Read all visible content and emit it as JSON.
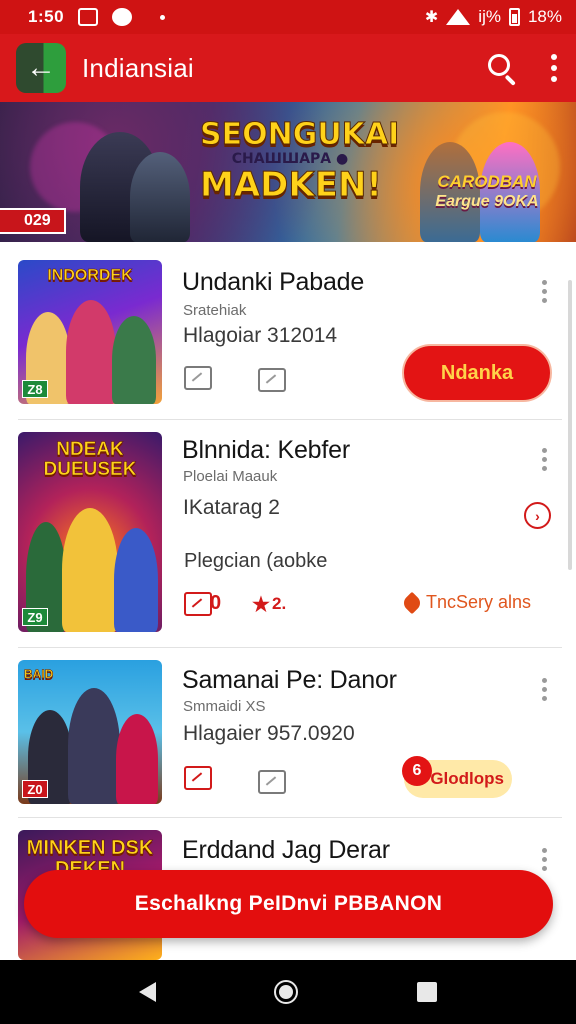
{
  "status_bar": {
    "time": "1:50",
    "battery_text": "іј%",
    "extra_text": "18%"
  },
  "app_bar": {
    "title": "Indiansiai",
    "back_icon": "arrow-left-icon",
    "search_icon": "search-icon",
    "menu_icon": "more-vert-icon"
  },
  "banner": {
    "headline_top": "SEONGUKAI",
    "headline_mid": "СНАШШАРА ●",
    "headline_bottom": "MADKEN!",
    "sub_line1": "CARODBAN",
    "sub_line2": "Eargue 9OKA",
    "badge": "029"
  },
  "items": [
    {
      "thumb_label": "INDORDEK",
      "thumb_badge": "Z8",
      "title": "Undanki Pabade",
      "subtitle": "Sratehiak",
      "meta": "Hlagoiar 312014",
      "action_label": "Ndanka",
      "colors": [
        "#2a4ac8",
        "#b3205a",
        "#f2a23a"
      ]
    },
    {
      "thumb_label": "NDEAK DUEUSEK",
      "thumb_badge": "Z9",
      "title": "Blnnida: Kebfer",
      "subtitle": "Ploelai Maauk",
      "meta": "IKatarag 2",
      "status": "Plegcian (aobke",
      "rating_a": "0",
      "rating_b": "2.",
      "trend_label": "TncSery alns",
      "colors": [
        "#ff7a1a",
        "#7a2a9a",
        "#2a6a3a"
      ]
    },
    {
      "thumb_label": "BAID",
      "thumb_badge": "Z0",
      "title": "Samanai Pe: Danor",
      "subtitle": "Smmaidi XS",
      "meta": "Hlagaier 957.0920",
      "pill_label": "Glodlops",
      "pill_number": "6",
      "colors": [
        "#2aa0e0",
        "#7a3a1a",
        "#c8151b"
      ]
    },
    {
      "thumb_label": "MINKEN DSK DEKEN",
      "title": "Erddand Jag Derar",
      "colors": [
        "#3a1a5a",
        "#ffb11a",
        "#a01a6a"
      ]
    }
  ],
  "cta_label": "Eschalkng PeIDnvi PBBANON",
  "nav": {
    "back": "nav-back-icon",
    "home": "nav-home-icon",
    "recents": "nav-recents-icon"
  }
}
